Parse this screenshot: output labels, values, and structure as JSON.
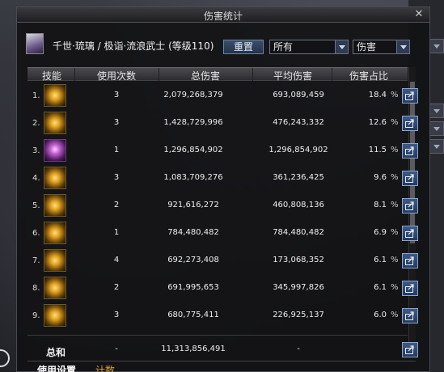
{
  "window": {
    "title": "伤害统计"
  },
  "header": {
    "character": "千世·琉璃 / 极诣·流浪武士 (等级110)",
    "reset_label": "重置",
    "filter_value": "所有",
    "metric_value": "伤害"
  },
  "table": {
    "columns": [
      "技能",
      "使用次数",
      "总伤害",
      "平均伤害",
      "伤害占比"
    ],
    "rows": [
      {
        "rank": "1.",
        "uses": "3",
        "total": "2,079,268,379",
        "avg": "693,089,459",
        "pct": "18.4",
        "pct_sign": "%",
        "icon": "skill-gold-burst-icon"
      },
      {
        "rank": "2.",
        "uses": "3",
        "total": "1,428,729,996",
        "avg": "476,243,332",
        "pct": "12.6",
        "pct_sign": "%",
        "icon": "skill-gold-slash-icon"
      },
      {
        "rank": "3.",
        "uses": "1",
        "total": "1,296,854,902",
        "avg": "1,296,854,902",
        "pct": "11.5",
        "pct_sign": "%",
        "icon": "skill-purple-awakening-icon"
      },
      {
        "rank": "4.",
        "uses": "3",
        "total": "1,083,709,276",
        "avg": "361,236,425",
        "pct": "9.6",
        "pct_sign": "%",
        "icon": "skill-cross-slash-icon"
      },
      {
        "rank": "5.",
        "uses": "2",
        "total": "921,616,272",
        "avg": "460,808,136",
        "pct": "8.1",
        "pct_sign": "%",
        "icon": "skill-gold-blade-icon"
      },
      {
        "rank": "6.",
        "uses": "1",
        "total": "784,480,482",
        "avg": "784,480,482",
        "pct": "6.9",
        "pct_sign": "%",
        "icon": "skill-gold-wave-icon"
      },
      {
        "rank": "7.",
        "uses": "4",
        "total": "692,273,408",
        "avg": "173,068,352",
        "pct": "6.1",
        "pct_sign": "%",
        "icon": "skill-gold-star-icon"
      },
      {
        "rank": "8.",
        "uses": "2",
        "total": "691,995,653",
        "avg": "345,997,826",
        "pct": "6.1",
        "pct_sign": "%",
        "icon": "skill-gold-warrior-icon"
      },
      {
        "rank": "9.",
        "uses": "3",
        "total": "680,775,411",
        "avg": "226,925,137",
        "pct": "6.0",
        "pct_sign": "%",
        "icon": "skill-gold-dash-icon"
      }
    ],
    "total": {
      "label": "总和",
      "uses": "-",
      "total": "11,313,856,491",
      "avg": "-"
    }
  },
  "tabs": [
    {
      "label": "使用设置",
      "active": true
    },
    {
      "label": "计数",
      "active": false
    }
  ],
  "colors": {
    "accent": "#d8a030",
    "button": "#3d5a86",
    "header_bg": "#3a3a40"
  }
}
